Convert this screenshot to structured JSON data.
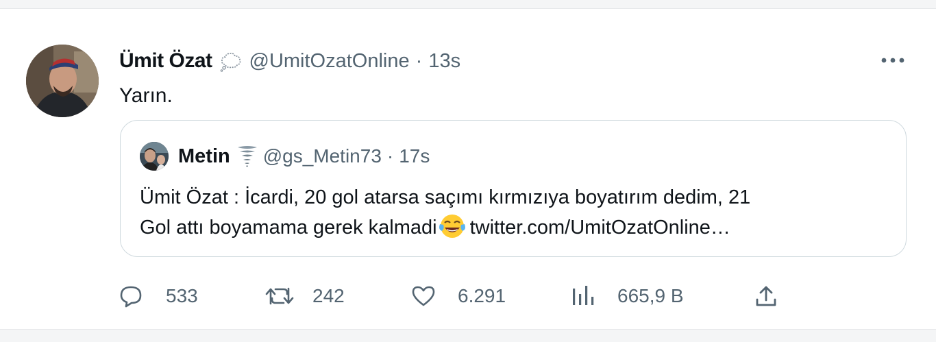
{
  "tweet": {
    "author_name": "Ümit Özat",
    "author_handle": "@UmitOzatOnline",
    "separator": "·",
    "time": "13s",
    "text": "Yarın."
  },
  "quote": {
    "author_name": "Metin",
    "author_handle": "@gs_Metin73",
    "separator": "·",
    "time": "17s",
    "text_line1": "Ümit Özat : İcardi, 20 gol atarsa saçımı kırmızıya boyatırım dedim, 21",
    "text_line2_before_emoji": "Gol attı boyamama gerek kalmadi",
    "text_line2_link": "twitter.com/UmitOzatOnline…",
    "emoji": "face-with-tears-of-joy"
  },
  "actions": {
    "replies": "533",
    "retweets": "242",
    "likes": "6.291",
    "views": "665,9 B"
  },
  "icons": {
    "more": "more-dots-icon",
    "reply": "reply-bubble-icon",
    "retweet": "retweet-icon",
    "like": "heart-icon",
    "views": "views-bar-chart-icon",
    "share": "share-upload-icon"
  },
  "colors": {
    "text_primary": "#0f1419",
    "text_secondary": "#536471",
    "border": "#cfd9de"
  }
}
